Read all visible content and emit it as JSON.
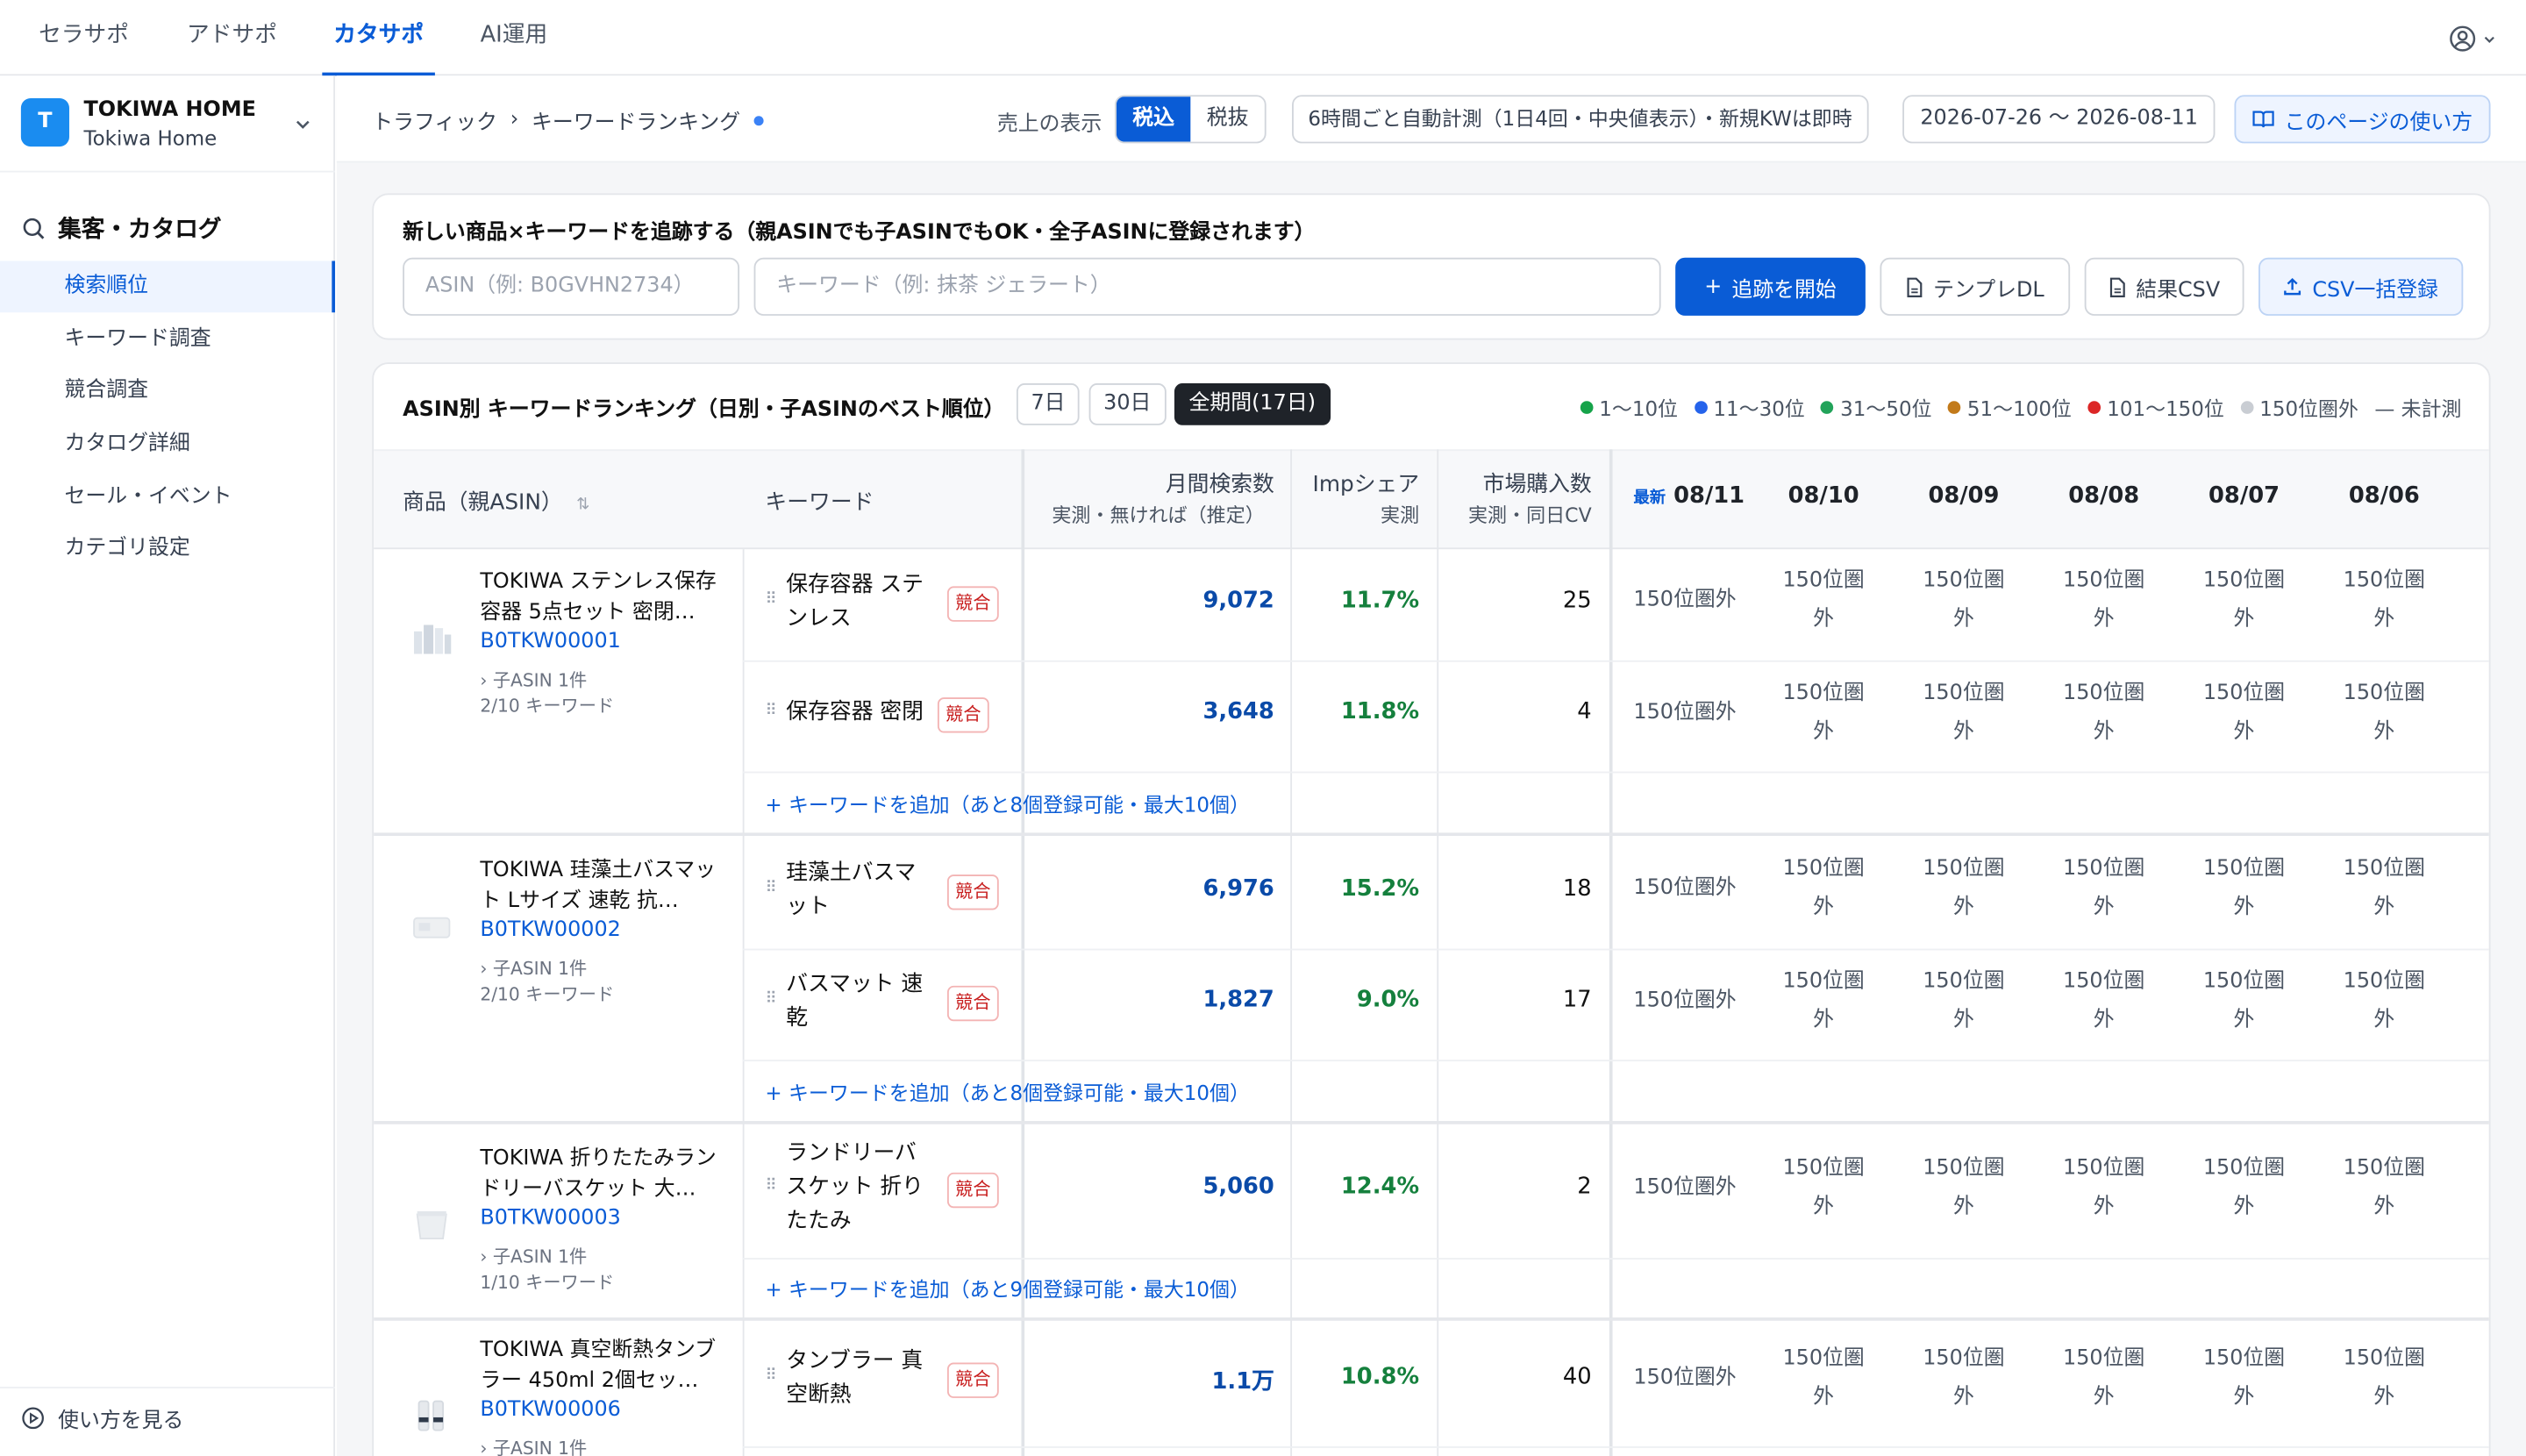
{
  "topnav": {
    "tabs": [
      "セラサポ",
      "アドサポ",
      "カタサポ",
      "AI運用"
    ],
    "active": 2
  },
  "sidebar": {
    "brand_name": "TOKIWA HOME",
    "brand_sub": "Tokiwa Home",
    "logo_letter": "T",
    "section": "集客・カタログ",
    "items": [
      "検索順位",
      "キーワード調査",
      "競合調査",
      "カタログ詳細",
      "セール・イベント",
      "カテゴリ設定"
    ],
    "help": "使い方を見る"
  },
  "header": {
    "crumb1": "トラフィック",
    "crumb_sep": "›",
    "crumb2": "キーワードランキング",
    "sale_label": "売上の表示",
    "tax_in": "税込",
    "tax_out": "税抜",
    "auto_note": "6時間ごと自動計測（1日4回・中央値表示）・新規KWは即時",
    "date_range": "2026-07-26 〜 2026-08-11",
    "how_to": "このページの使い方"
  },
  "add": {
    "title": "新しい商品×キーワードを追跡する（親ASINでも子ASINでもOK・全子ASINに登録されます）",
    "asin_placeholder": "ASIN（例: B0GVHN2734）",
    "kw_placeholder": "キーワード（例: 抹茶 ジェラート）",
    "start": "追跡を開始",
    "template": "テンプレDL",
    "result_csv": "結果CSV",
    "bulk_csv": "CSV一括登録"
  },
  "table": {
    "title": "ASIN別 キーワードランキング（日別・子ASINのベスト順位）",
    "periods": [
      "7日",
      "30日",
      "全期間(17日)"
    ],
    "legend": [
      {
        "label": "1〜10位",
        "color": "#16a34a"
      },
      {
        "label": "11〜30位",
        "color": "#2563eb"
      },
      {
        "label": "31〜50位",
        "color": "#22a35a"
      },
      {
        "label": "51〜100位",
        "color": "#c27a1a"
      },
      {
        "label": "101〜150位",
        "color": "#dc2626"
      },
      {
        "label": "150位圏外",
        "color": "#c9cdd3"
      }
    ],
    "legend_unmeasured": "— 未計測",
    "col_product": "商品（親ASIN）",
    "sort_icon": "⇅",
    "col_keyword": "キーワード",
    "col_volume": "月間検索数",
    "col_volume_sub": "実測・無ければ（推定）",
    "col_imp": "Impシェア",
    "col_imp_sub": "実測",
    "col_purchase": "市場購入数",
    "col_purchase_sub": "実測・同日CV",
    "latest_tag": "最新",
    "dates": [
      "08/11",
      "08/10",
      "08/09",
      "08/08",
      "08/07",
      "08/06"
    ],
    "competitor_badge": "競合",
    "outside_rank": "150位圏外",
    "outside_rank_l1": "150位圏",
    "outside_rank_l2": "外"
  },
  "products": [
    {
      "name": "TOKIWA ステンレス保存容器 5点セット 密閉…",
      "asin": "B0TKW00001",
      "child": "› 子ASIN 1件",
      "kwcount": "2/10 キーワード",
      "add_kw": "+ キーワードを追加（あと8個登録可能・最大10個）",
      "rows": [
        {
          "keyword": "保存容器 ステンレス",
          "volume": "9,072",
          "imp": "11.7%",
          "purchases": "25"
        },
        {
          "keyword": "保存容器 密閉",
          "volume": "3,648",
          "imp": "11.8%",
          "purchases": "4"
        }
      ]
    },
    {
      "name": "TOKIWA 珪藻土バスマット Lサイズ 速乾 抗…",
      "asin": "B0TKW00002",
      "child": "› 子ASIN 1件",
      "kwcount": "2/10 キーワード",
      "add_kw": "+ キーワードを追加（あと8個登録可能・最大10個）",
      "rows": [
        {
          "keyword": "珪藻土バスマット",
          "volume": "6,976",
          "imp": "15.2%",
          "purchases": "18"
        },
        {
          "keyword": "バスマット 速乾",
          "volume": "1,827",
          "imp": "9.0%",
          "purchases": "17"
        }
      ]
    },
    {
      "name": "TOKIWA 折りたたみランドリーバスケット 大…",
      "asin": "B0TKW00003",
      "child": "› 子ASIN 1件",
      "kwcount": "1/10 キーワード",
      "add_kw": "+ キーワードを追加（あと9個登録可能・最大10個）",
      "rows": [
        {
          "keyword": "ランドリーバスケット 折りたたみ",
          "volume": "5,060",
          "imp": "12.4%",
          "purchases": "2"
        }
      ]
    },
    {
      "name": "TOKIWA 真空断熱タンブラー 450ml 2個セッ…",
      "asin": "B0TKW00006",
      "child": "› 子ASIN 1件",
      "kwcount": "",
      "add_kw": "",
      "rows": [
        {
          "keyword": "タンブラー 真空断熱",
          "volume": "1.1万",
          "imp": "10.8%",
          "purchases": "40"
        }
      ]
    }
  ]
}
